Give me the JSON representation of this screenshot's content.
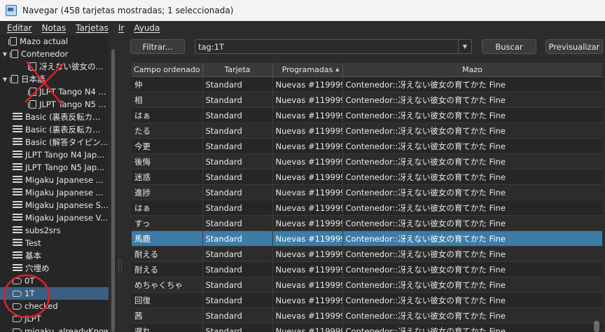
{
  "window": {
    "title": "Navegar (458 tarjetas mostradas; 1 seleccionada)"
  },
  "menu": [
    "Editar",
    "Notas",
    "Tarjetas",
    "Ir",
    "Ayuda"
  ],
  "sidebar": {
    "items": [
      {
        "label": "Mazo actual",
        "icon": "deck-icon",
        "indent": 1,
        "arrow": ""
      },
      {
        "label": "Contenedor",
        "icon": "deck-icon",
        "indent": 0,
        "arrow": "▼"
      },
      {
        "label": "冴えない彼女の...",
        "icon": "deck-icon",
        "indent": 2,
        "arrow": ""
      },
      {
        "label": "日本語",
        "icon": "deck-icon",
        "indent": 0,
        "arrow": "▼"
      },
      {
        "label": "JLPT Tango N4 ...",
        "icon": "deck-icon",
        "indent": 2,
        "arrow": ""
      },
      {
        "label": "JLPT Tango N5 ...",
        "icon": "deck-icon",
        "indent": 2,
        "arrow": ""
      },
      {
        "label": "Basic (裏表反転カ...",
        "icon": "note-icon",
        "indent": 1,
        "arrow": ""
      },
      {
        "label": "Basic (裏表反転カ...",
        "icon": "note-icon",
        "indent": 1,
        "arrow": ""
      },
      {
        "label": "Basic (解答タイピン...",
        "icon": "note-icon",
        "indent": 1,
        "arrow": ""
      },
      {
        "label": "JLPT Tango N4 Jap...",
        "icon": "note-icon",
        "indent": 1,
        "arrow": ""
      },
      {
        "label": "JLPT Tango N5 Jap...",
        "icon": "note-icon",
        "indent": 1,
        "arrow": ""
      },
      {
        "label": "Migaku Japanese ...",
        "icon": "note-icon",
        "indent": 1,
        "arrow": ""
      },
      {
        "label": "Migaku Japanese ...",
        "icon": "note-icon",
        "indent": 1,
        "arrow": ""
      },
      {
        "label": "Migaku Japanese S...",
        "icon": "note-icon",
        "indent": 1,
        "arrow": ""
      },
      {
        "label": "Migaku Japanese V...",
        "icon": "note-icon",
        "indent": 1,
        "arrow": ""
      },
      {
        "label": "subs2srs",
        "icon": "note-icon",
        "indent": 1,
        "arrow": ""
      },
      {
        "label": "Test",
        "icon": "note-icon",
        "indent": 1,
        "arrow": ""
      },
      {
        "label": "基本",
        "icon": "note-icon",
        "indent": 1,
        "arrow": ""
      },
      {
        "label": "穴埋め",
        "icon": "note-icon",
        "indent": 1,
        "arrow": ""
      },
      {
        "label": "0T",
        "icon": "tag-icon",
        "indent": 1,
        "arrow": ""
      },
      {
        "label": "1T",
        "icon": "tag-icon",
        "indent": 1,
        "arrow": "",
        "selected": true
      },
      {
        "label": "checked",
        "icon": "tag-icon",
        "indent": 1,
        "arrow": ""
      },
      {
        "label": "JLPT",
        "icon": "tag-icon",
        "indent": 1,
        "arrow": ""
      },
      {
        "label": "migaku_alreadyKnown",
        "icon": "tag-icon",
        "indent": 1,
        "arrow": ""
      }
    ]
  },
  "toolbar": {
    "filter_label": "Filtrar...",
    "search_value": "tag:1T",
    "search_label": "Buscar",
    "preview_label": "Previsualizar"
  },
  "table": {
    "columns": [
      "Campo ordenado",
      "Tarjeta",
      "Programadas",
      "Mazo"
    ],
    "rows": [
      [
        "仲",
        "Standard",
        "Nuevas #1199996",
        "Contenedor::冴えない彼女の育てかた Fine"
      ],
      [
        "相",
        "Standard",
        "Nuevas #1199996",
        "Contenedor::冴えない彼女の育てかた Fine"
      ],
      [
        "はぁ",
        "Standard",
        "Nuevas #1199996",
        "Contenedor::冴えない彼女の育てかた Fine"
      ],
      [
        "たる",
        "Standard",
        "Nuevas #1199996",
        "Contenedor::冴えない彼女の育てかた Fine"
      ],
      [
        "今更",
        "Standard",
        "Nuevas #1199996",
        "Contenedor::冴えない彼女の育てかた Fine"
      ],
      [
        "後悔",
        "Standard",
        "Nuevas #1199996",
        "Contenedor::冴えない彼女の育てかた Fine"
      ],
      [
        "迷惑",
        "Standard",
        "Nuevas #1199996",
        "Contenedor::冴えない彼女の育てかた Fine"
      ],
      [
        "進捗",
        "Standard",
        "Nuevas #1199996",
        "Contenedor::冴えない彼女の育てかた Fine"
      ],
      [
        "はぁ",
        "Standard",
        "Nuevas #1199996",
        "Contenedor::冴えない彼女の育てかた Fine"
      ],
      [
        "すっ",
        "Standard",
        "Nuevas #1199996",
        "Contenedor::冴えない彼女の育てかた Fine"
      ],
      [
        "馬鹿",
        "Standard",
        "Nuevas #1199996",
        "Contenedor::冴えない彼女の育てかた Fine"
      ],
      [
        "耐える",
        "Standard",
        "Nuevas #1199996",
        "Contenedor::冴えない彼女の育てかた Fine"
      ],
      [
        "耐える",
        "Standard",
        "Nuevas #1199996",
        "Contenedor::冴えない彼女の育てかた Fine"
      ],
      [
        "めちゃくちゃ",
        "Standard",
        "Nuevas #1199996",
        "Contenedor::冴えない彼女の育てかた Fine"
      ],
      [
        "回復",
        "Standard",
        "Nuevas #1199996",
        "Contenedor::冴えない彼女の育てかた Fine"
      ],
      [
        "茜",
        "Standard",
        "Nuevas #1199996",
        "Contenedor::冴えない彼女の育てかた Fine"
      ],
      [
        "遅れ",
        "Standard",
        "Nuevas #1199996",
        "Contenedor::冴えない彼女の育てかた Fine"
      ]
    ],
    "selected_row": 10
  },
  "colors": {
    "accent": "#3e7ba6",
    "annotation": "#e0202a"
  }
}
